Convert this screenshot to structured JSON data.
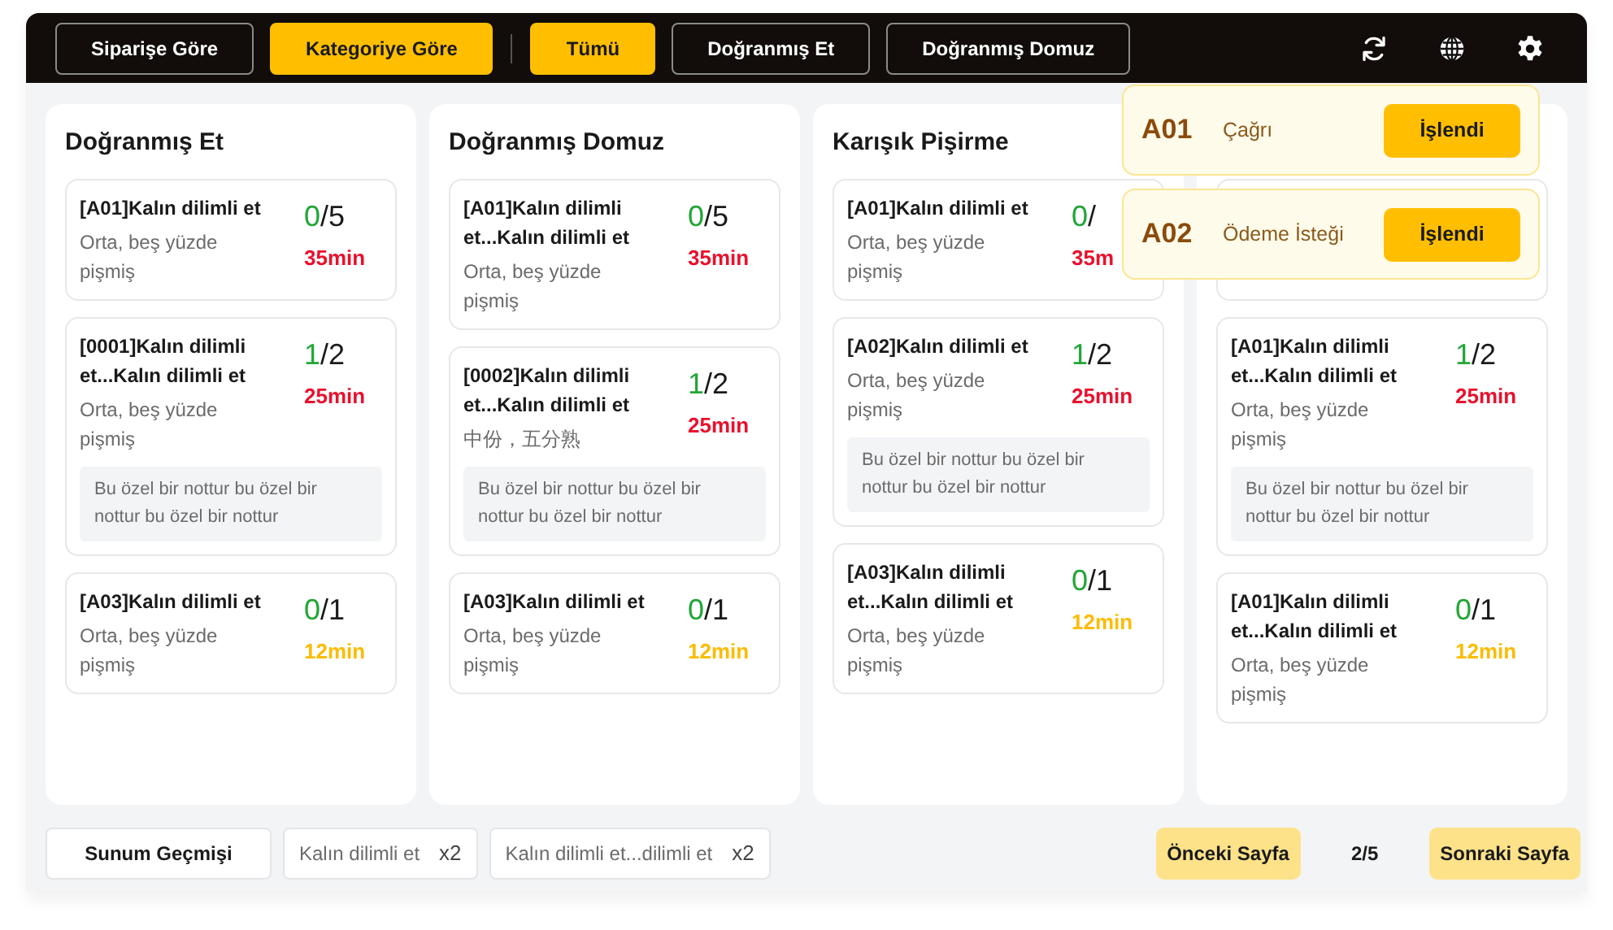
{
  "toolbar": {
    "view_tabs": [
      {
        "label": "Siparişe Göre",
        "selected": false
      },
      {
        "label": "Kategoriye Göre",
        "selected": true
      }
    ],
    "filter_tabs": [
      {
        "label": "Tümü",
        "selected": true
      },
      {
        "label": "Doğranmış Et",
        "selected": false
      },
      {
        "label": "Doğranmış Domuz",
        "selected": false
      }
    ]
  },
  "columns": [
    {
      "title": "Doğranmış Et",
      "cards": [
        {
          "kind": "order",
          "name": "[A01]Kalın dilimli et",
          "desc": "Orta, beş yüzde pişmiş",
          "done": "0",
          "rest": "/5",
          "time": "35min",
          "color": "#e8112d"
        },
        {
          "kind": "order",
          "name": "[0001]Kalın dilimli et...Kalın dilimli et",
          "desc": "Orta, beş yüzde pişmiş",
          "done": "1",
          "rest": "/2",
          "time": "25min",
          "color": "#e8112d",
          "note": "Bu özel bir nottur bu özel bir nottur bu özel bir nottur"
        },
        {
          "kind": "order",
          "name": "[A03]Kalın dilimli et",
          "desc": "Orta, beş yüzde pişmiş",
          "done": "0",
          "rest": "/1",
          "time": "12min",
          "color": "#fbbc05"
        }
      ]
    },
    {
      "title": "Doğranmış Domuz",
      "cards": [
        {
          "kind": "order",
          "name": "[A01]Kalın dilimli et...Kalın dilimli et",
          "desc": "Orta, beş yüzde pişmiş",
          "done": "0",
          "rest": "/5",
          "time": "35min",
          "color": "#e8112d"
        },
        {
          "kind": "order",
          "name": "[0002]Kalın dilimli et...Kalın dilimli et",
          "desc": "中份，五分熟",
          "done": "1",
          "rest": "/2",
          "time": "25min",
          "color": "#e8112d",
          "note": "Bu özel bir nottur bu özel bir nottur bu özel bir nottur"
        },
        {
          "kind": "order",
          "name": "[A03]Kalın dilimli et",
          "desc": "Orta, beş yüzde pişmiş",
          "done": "0",
          "rest": "/1",
          "time": "12min",
          "color": "#fbbc05"
        }
      ]
    },
    {
      "title": "Karışık Pişirme",
      "cards": [
        {
          "kind": "order",
          "name": "[A01]Kalın dilimli et",
          "desc": "Orta, beş yüzde pişmiş",
          "done": "0",
          "rest": "/",
          "time": "35m",
          "color": "#e8112d"
        },
        {
          "kind": "order",
          "name": "[A02]Kalın dilimli et",
          "desc": "Orta, beş yüzde pişmiş",
          "done": "1",
          "rest": "/2",
          "time": "25min",
          "color": "#e8112d",
          "note": "Bu özel bir nottur bu özel bir nottur bu özel bir nottur"
        },
        {
          "kind": "order",
          "name": "[A03]Kalın dilimli et...Kalın dilimli et",
          "desc": "Orta, beş yüzde pişmiş",
          "done": "0",
          "rest": "/1",
          "time": "12min",
          "color": "#fbbc05"
        }
      ]
    },
    {
      "cards": [
        {
          "kind": "covered"
        },
        {
          "kind": "order",
          "name": "[A01]Kalın dilimli et...Kalın dilimli et",
          "desc": "Orta, beş yüzde pişmiş",
          "done": "1",
          "rest": "/2",
          "time": "25min",
          "color": "#e8112d",
          "note": "Bu özel bir nottur bu özel bir nottur bu özel bir nottur"
        },
        {
          "kind": "order",
          "name": "[A01]Kalın dilimli et...Kalın dilimli et",
          "desc": "Orta, beş yüzde pişmiş",
          "done": "0",
          "rest": "/1",
          "time": "12min",
          "color": "#fbbc05"
        }
      ]
    }
  ],
  "notifications": [
    {
      "table": "A01",
      "message": "Çağrı",
      "button": "İşlendi"
    },
    {
      "table": "A02",
      "message": "Ödeme İsteği",
      "button": "İşlendi"
    }
  ],
  "footer": {
    "history_button": "Sunum Geçmişi",
    "chips": [
      {
        "label": "Kalın dilimli et",
        "count": "x2"
      },
      {
        "label": "Kalın dilimli et...dilimli et",
        "count": "x2"
      }
    ],
    "prev_button": "Önceki Sayfa",
    "page": "2/5",
    "next_button": "Sonraki Sayfa"
  }
}
